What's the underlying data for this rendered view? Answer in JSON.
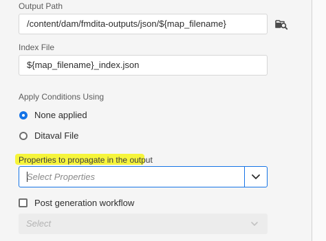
{
  "output_path": {
    "label": "Output Path",
    "value": "/content/dam/fmdita-outputs/json/${map_filename}",
    "browse_icon": "folder-search-icon"
  },
  "index_file": {
    "label": "Index File",
    "value": "${map_filename}_index.json"
  },
  "apply_conditions": {
    "label": "Apply Conditions Using",
    "options": [
      {
        "label": "None applied",
        "selected": true
      },
      {
        "label": "Ditaval File",
        "selected": false
      }
    ]
  },
  "properties": {
    "label": "Properties to propagate in the output",
    "placeholder": "Select Properties",
    "dropdown_icon": "chevron-down-icon",
    "highlight_color": "#f6f53b"
  },
  "post_generation": {
    "label": "Post generation workflow",
    "checked": false,
    "select_placeholder": "Select"
  },
  "colors": {
    "accent": "#1473e6",
    "field_border": "#d6d6d6",
    "background": "#f5f5f5"
  }
}
